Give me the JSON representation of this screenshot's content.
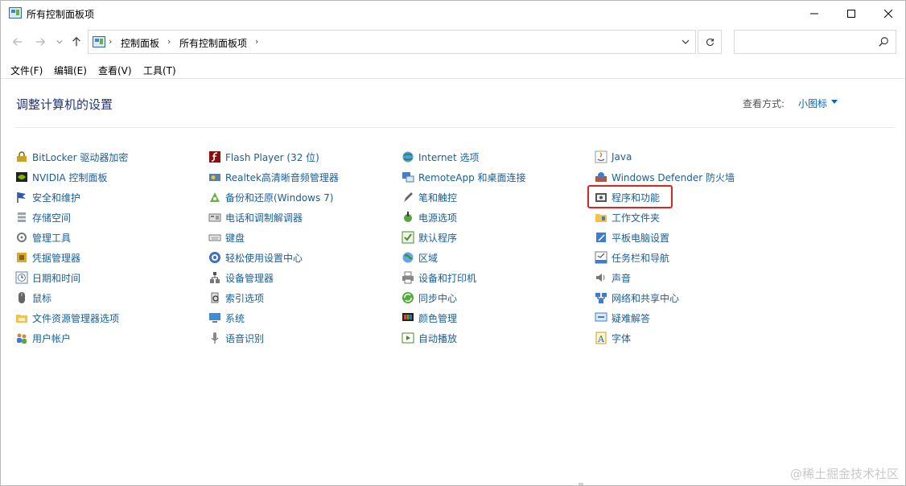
{
  "window": {
    "title": "所有控制面板项"
  },
  "address": {
    "breadcrumbs": [
      "控制面板",
      "所有控制面板项"
    ],
    "search_placeholder": ""
  },
  "menu": [
    "文件(F)",
    "编辑(E)",
    "查看(V)",
    "工具(T)"
  ],
  "header": {
    "title": "调整计算机的设置",
    "view_by_label": "查看方式:",
    "view_by_value": "小图标"
  },
  "columns": [
    {
      "items": [
        {
          "label": "BitLocker 驱动器加密",
          "icon": "bitlocker-icon"
        },
        {
          "label": "NVIDIA 控制面板",
          "icon": "nvidia-icon"
        },
        {
          "label": "安全和维护",
          "icon": "flag-icon"
        },
        {
          "label": "存储空间",
          "icon": "storage-icon"
        },
        {
          "label": "管理工具",
          "icon": "tools-icon"
        },
        {
          "label": "凭据管理器",
          "icon": "credential-icon"
        },
        {
          "label": "日期和时间",
          "icon": "clock-icon"
        },
        {
          "label": "鼠标",
          "icon": "mouse-icon"
        },
        {
          "label": "文件资源管理器选项",
          "icon": "folder-options-icon"
        },
        {
          "label": "用户帐户",
          "icon": "users-icon"
        }
      ]
    },
    {
      "items": [
        {
          "label": "Flash Player (32 位)",
          "icon": "flash-icon"
        },
        {
          "label": "Realtek高清晰音频管理器",
          "icon": "realtek-icon"
        },
        {
          "label": "备份和还原(Windows 7)",
          "icon": "backup-icon"
        },
        {
          "label": "电话和调制解调器",
          "icon": "modem-icon"
        },
        {
          "label": "键盘",
          "icon": "keyboard-icon"
        },
        {
          "label": "轻松使用设置中心",
          "icon": "ease-of-access-icon"
        },
        {
          "label": "设备管理器",
          "icon": "device-manager-icon"
        },
        {
          "label": "索引选项",
          "icon": "indexing-icon"
        },
        {
          "label": "系统",
          "icon": "system-icon"
        },
        {
          "label": "语音识别",
          "icon": "microphone-icon"
        }
      ]
    },
    {
      "items": [
        {
          "label": "Internet 选项",
          "icon": "internet-icon"
        },
        {
          "label": "RemoteApp 和桌面连接",
          "icon": "remoteapp-icon"
        },
        {
          "label": "笔和触控",
          "icon": "pen-icon"
        },
        {
          "label": "电源选项",
          "icon": "power-icon"
        },
        {
          "label": "默认程序",
          "icon": "default-programs-icon"
        },
        {
          "label": "区域",
          "icon": "region-icon"
        },
        {
          "label": "设备和打印机",
          "icon": "printer-icon"
        },
        {
          "label": "同步中心",
          "icon": "sync-icon"
        },
        {
          "label": "颜色管理",
          "icon": "color-management-icon"
        },
        {
          "label": "自动播放",
          "icon": "autoplay-icon"
        }
      ]
    },
    {
      "items": [
        {
          "label": "Java",
          "icon": "java-icon"
        },
        {
          "label": "Windows Defender 防火墙",
          "icon": "firewall-icon"
        },
        {
          "label": "程序和功能",
          "icon": "programs-icon",
          "highlighted": true
        },
        {
          "label": "工作文件夹",
          "icon": "work-folders-icon"
        },
        {
          "label": "平板电脑设置",
          "icon": "tablet-icon"
        },
        {
          "label": "任务栏和导航",
          "icon": "taskbar-icon"
        },
        {
          "label": "声音",
          "icon": "speaker-icon"
        },
        {
          "label": "网络和共享中心",
          "icon": "network-icon"
        },
        {
          "label": "疑难解答",
          "icon": "troubleshoot-icon"
        },
        {
          "label": "字体",
          "icon": "font-icon"
        }
      ]
    }
  ],
  "watermark": "@稀土掘金技术社区"
}
